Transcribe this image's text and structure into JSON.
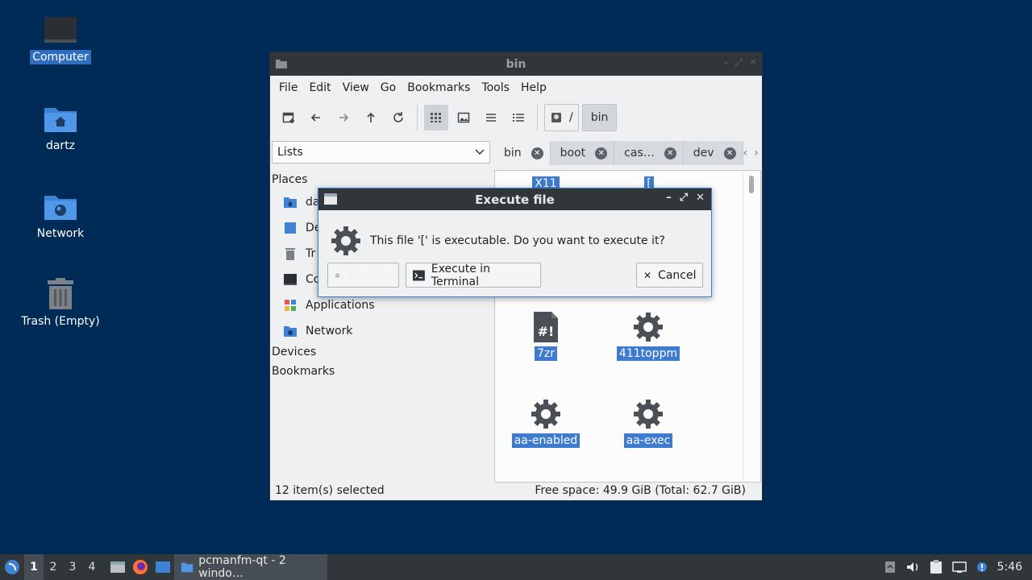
{
  "desktop": {
    "icons": [
      {
        "label": "Computer"
      },
      {
        "label": "dartz"
      },
      {
        "label": "Network"
      },
      {
        "label": "Trash (Empty)"
      }
    ]
  },
  "window": {
    "title": "bin",
    "menu": [
      "File",
      "Edit",
      "View",
      "Go",
      "Bookmarks",
      "Tools",
      "Help"
    ],
    "path_root": "/",
    "path_current": "bin",
    "sidebar_mode": "Lists",
    "tabs": [
      {
        "label": "bin"
      },
      {
        "label": "boot"
      },
      {
        "label": "cas…"
      },
      {
        "label": "dev"
      }
    ],
    "sidebar": {
      "places_header": "Places",
      "items": [
        {
          "label": "da"
        },
        {
          "label": "De"
        },
        {
          "label": "Tr"
        },
        {
          "label": "Co"
        },
        {
          "label": "Applications"
        },
        {
          "label": "Network"
        }
      ],
      "devices_header": "Devices",
      "bookmarks_header": "Bookmarks"
    },
    "files": [
      {
        "name": "X11"
      },
      {
        "name": "["
      },
      {
        "name": "7zr"
      },
      {
        "name": "411toppm"
      },
      {
        "name": "aa-enabled"
      },
      {
        "name": "aa-exec"
      }
    ],
    "status_left": "12 item(s) selected",
    "status_right": "Free space: 49.9 GiB (Total: 62.7 GiB)"
  },
  "dialog": {
    "title": "Execute file",
    "message": "This file '[' is executable. Do you want to execute it?",
    "execute_label": "Execute",
    "execute_terminal_label": "Execute in Terminal",
    "cancel_label": "Cancel"
  },
  "taskbar": {
    "workspaces": [
      "1",
      "2",
      "3",
      "4"
    ],
    "task_label": "pcmanfm-qt - 2 windo…",
    "clock": "5:46"
  },
  "colors": {
    "desktop_bg": "#002b57",
    "titlebar": "#31363b",
    "selection": "#3d7bd0"
  }
}
